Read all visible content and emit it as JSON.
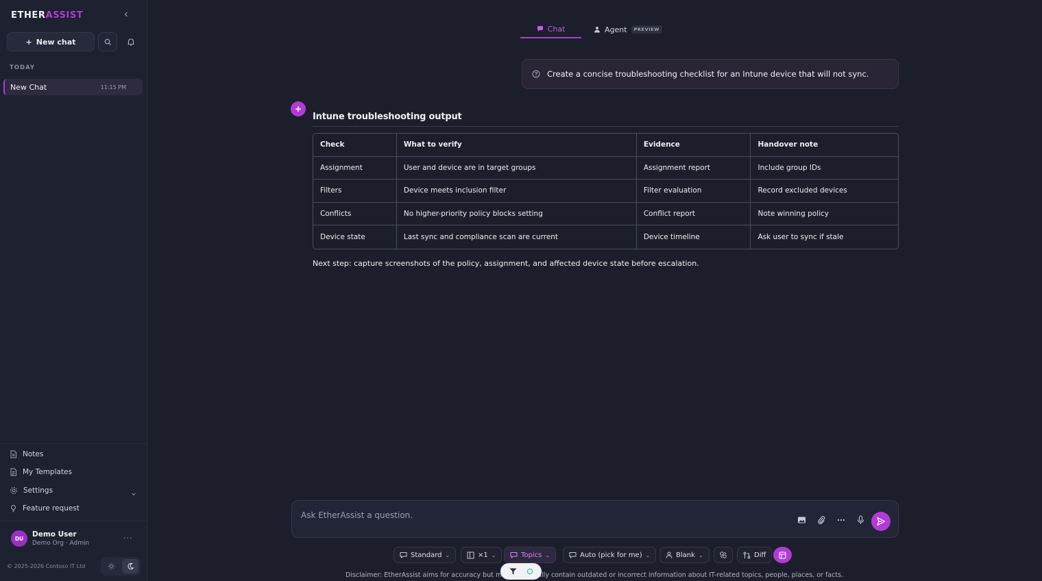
{
  "brand": {
    "part1": "ETHER",
    "part2": "ASSIST"
  },
  "sidebar": {
    "new_chat_label": "New chat",
    "section_today": "TODAY",
    "chats": [
      {
        "title": "New Chat",
        "time": "11:15 PM"
      }
    ],
    "nav": [
      {
        "label": "Notes",
        "icon": "notes-icon"
      },
      {
        "label": "My Templates",
        "icon": "template-icon"
      },
      {
        "label": "Settings",
        "icon": "gear-icon"
      },
      {
        "label": "Feature request",
        "icon": "lightbulb-icon"
      }
    ],
    "user": {
      "initials": "DU",
      "name": "Demo User",
      "role": "Demo Org · Admin"
    },
    "copyright": "© 2025-2026 Contoso IT Ltd"
  },
  "tabs": {
    "chat": "Chat",
    "agent": "Agent",
    "agent_badge": "PREVIEW"
  },
  "conversation": {
    "user_prompt": "Create a concise troubleshooting checklist for an Intune device that will not sync.",
    "response_title": "Intune troubleshooting output",
    "table": {
      "headers": [
        "Check",
        "What to verify",
        "Evidence",
        "Handover note"
      ],
      "rows": [
        [
          "Assignment",
          "User and device are in target groups",
          "Assignment report",
          "Include group IDs"
        ],
        [
          "Filters",
          "Device meets inclusion filter",
          "Filter evaluation",
          "Record excluded devices"
        ],
        [
          "Conflicts",
          "No higher-priority policy blocks setting",
          "Conflict report",
          "Note winning policy"
        ],
        [
          "Device state",
          "Last sync and compliance scan are current",
          "Device timeline",
          "Ask user to sync if stale"
        ]
      ]
    },
    "next_step": "Next step: capture screenshots of the policy, assignment, and affected device state before escalation."
  },
  "composer": {
    "placeholder": "Ask EtherAssist a question."
  },
  "toolbar": {
    "mode": "Standard",
    "count": "×1",
    "topics": "Topics",
    "model": "Auto (pick for me)",
    "persona": "Blank",
    "diff": "Diff"
  },
  "disclaimer": {
    "left": "Disclaimer: EtherAssist aims for accuracy but m",
    "right": "ally contain outdated or incorrect information about IT-related topics, people, places, or facts."
  },
  "colors": {
    "accent": "#b13bd6",
    "background": "#1c1f2b",
    "sidebar": "#1e2130"
  }
}
